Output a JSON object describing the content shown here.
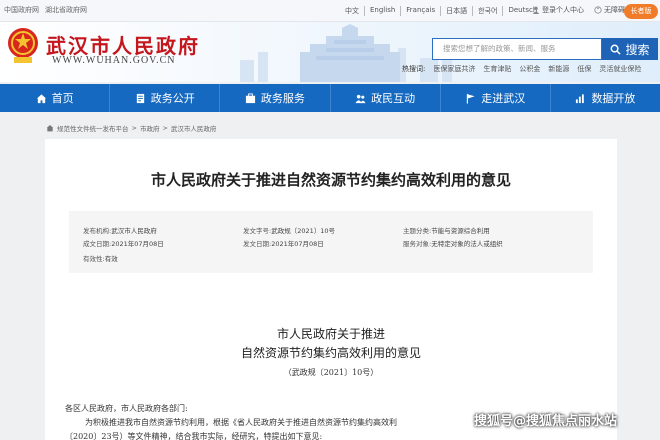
{
  "topbar": {
    "links": [
      "中国政府网",
      "湖北省政府网"
    ],
    "languages": [
      "中文",
      "English",
      "Français",
      "日本語",
      "한국어",
      "Deutsch"
    ],
    "login_label": "登录个人中心",
    "accessible_label": "无障碍",
    "elder_label": "长者版"
  },
  "header": {
    "site_name": "武汉市人民政府",
    "site_url": "WWW.WUHAN.GOV.CN",
    "search_placeholder": "搜索您想了解的政策、新闻、服务",
    "search_button": "搜索",
    "hot_label": "热搜词:",
    "hot_words": [
      "医保家庭共济",
      "生育津贴",
      "公积金",
      "新能源",
      "低保",
      "灵活就业保险"
    ]
  },
  "nav": [
    {
      "label": "首页",
      "icon": "home-icon"
    },
    {
      "label": "政务公开",
      "icon": "doc-icon"
    },
    {
      "label": "政务服务",
      "icon": "service-icon"
    },
    {
      "label": "政民互动",
      "icon": "interact-icon"
    },
    {
      "label": "走进武汉",
      "icon": "flag-icon"
    },
    {
      "label": "数据开放",
      "icon": "chart-icon"
    }
  ],
  "breadcrumb": [
    "规范性文件统一发布平台",
    "市政府",
    "武汉市人民政府"
  ],
  "article": {
    "title": "市人民政府关于推进自然资源节约集约高效利用的意见",
    "meta": {
      "publisher_k": "发布机构:",
      "publisher_v": "武汉市人民政府",
      "docno_k": "发文字号:",
      "docno_v": "武政规〔2021〕10号",
      "topic_k": "主题分类:",
      "topic_v": "节能与资源综合利用",
      "date_k": "成文日期:",
      "date_v": "2021年07月08日",
      "pubdate_k": "发文日期:",
      "pubdate_v": "2021年07月08日",
      "target_k": "服务对象:",
      "target_v": "无特定对象的法人或组织",
      "valid_k": "有效性:",
      "valid_v": "有效"
    },
    "body_title_1": "市人民政府关于推进",
    "body_title_2": "自然资源节约集约高效利用的意见",
    "doc_no": "（武政规〔2021〕10号）",
    "salutation": "各区人民政府，市人民政府各部门:",
    "para_1": "为积极推进我市自然资源节约利用，根据《省人民政府关于推进自然资源节约集约高效利",
    "para_2": "〔2020〕23号）等文件精神，结合我市实际，经研究，特提出如下意见:"
  },
  "watermark": "搜狐号@搜狐焦点丽水站",
  "colors": {
    "brand_red": "#c4161c",
    "nav_blue": "#1669c1",
    "elder_orange": "#f07c2a"
  }
}
